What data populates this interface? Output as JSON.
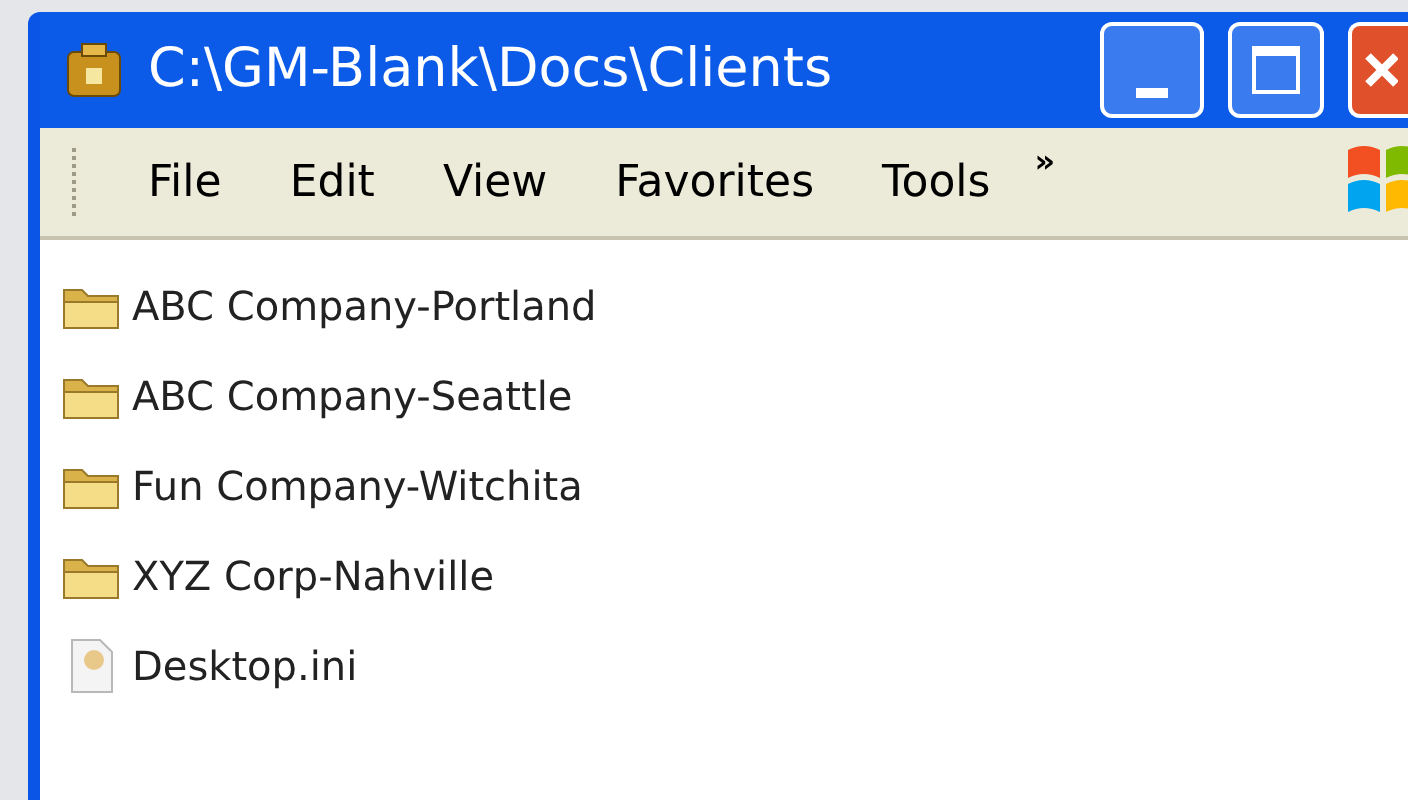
{
  "window": {
    "title": "C:\\GM-Blank\\Docs\\Clients"
  },
  "menu": [
    "File",
    "Edit",
    "View",
    "Favorites",
    "Tools"
  ],
  "menu_overflow": "»",
  "files": [
    {
      "name": "ABC Company-Portland",
      "kind": "folder"
    },
    {
      "name": "ABC Company-Seattle",
      "kind": "folder"
    },
    {
      "name": "Fun Company-Witchita",
      "kind": "folder"
    },
    {
      "name": "XYZ Corp-Nahville",
      "kind": "folder"
    },
    {
      "name": "Desktop.ini",
      "kind": "file"
    }
  ]
}
